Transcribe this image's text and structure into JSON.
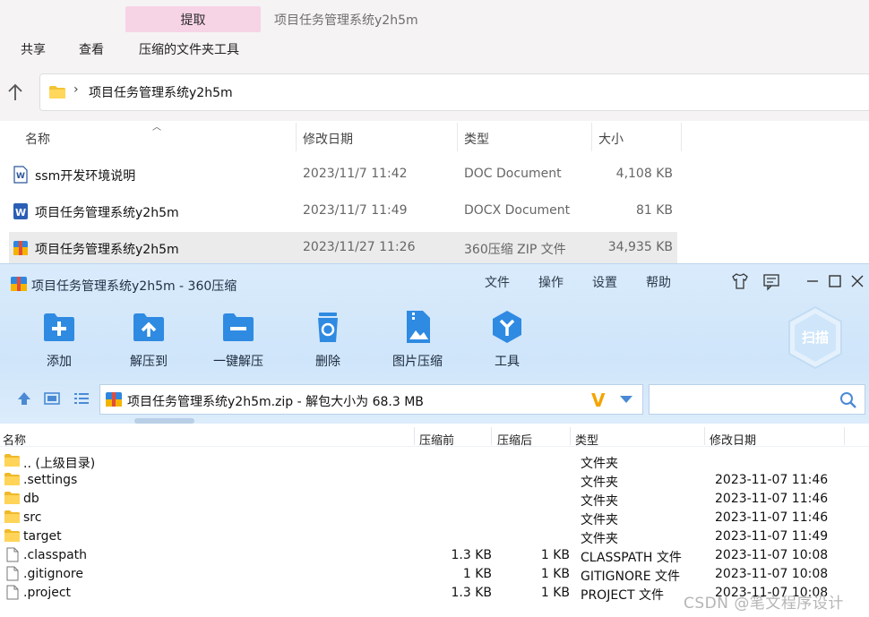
{
  "explorer": {
    "context_tab": "提取",
    "window_title": "项目任务管理系统y2h5m",
    "menus": [
      "共享",
      "查看",
      "压缩的文件夹工具"
    ],
    "address": {
      "path": "项目任务管理系统y2h5m"
    },
    "columns": {
      "name": "名称",
      "date": "修改日期",
      "type": "类型",
      "size": "大小"
    },
    "files": [
      {
        "name": "ssm开发环境说明",
        "date": "2023/11/7 11:42",
        "type": "DOC Document",
        "size": "4,108 KB",
        "icon": "word-doc-icon"
      },
      {
        "name": "项目任务管理系统y2h5m",
        "date": "2023/11/7 11:49",
        "type": "DOCX Document",
        "size": "81 KB",
        "icon": "word-docx-icon"
      },
      {
        "name": "项目任务管理系统y2h5m",
        "date": "2023/11/27 11:26",
        "type": "360压缩 ZIP 文件",
        "size": "34,935 KB",
        "icon": "zip-archive-icon"
      }
    ]
  },
  "zip_window": {
    "title": "项目任务管理系统y2h5m - 360压缩",
    "menus": [
      "文件",
      "操作",
      "设置",
      "帮助"
    ],
    "toolbar": [
      {
        "label": "添加",
        "icon": "add-icon"
      },
      {
        "label": "解压到",
        "icon": "extract-to-icon"
      },
      {
        "label": "一键解压",
        "icon": "one-click-extract-icon"
      },
      {
        "label": "删除",
        "icon": "recycle-delete-icon"
      },
      {
        "label": "图片压缩",
        "icon": "image-compress-icon"
      },
      {
        "label": "工具",
        "icon": "tools-icon"
      }
    ],
    "scan_label": "扫描",
    "path_text": "项目任务管理系统y2h5m.zip - 解包大小为 68.3 MB",
    "search_placeholder": "",
    "columns": {
      "name": "名称",
      "before": "压缩前",
      "after": "压缩后",
      "type": "类型",
      "date": "修改日期"
    },
    "rows": [
      {
        "name": ".. (上级目录)",
        "before": "",
        "after": "",
        "type": "文件夹",
        "date": "",
        "icon": "folder-icon"
      },
      {
        "name": ".settings",
        "before": "",
        "after": "",
        "type": "文件夹",
        "date": "2023-11-07 11:46",
        "icon": "folder-icon"
      },
      {
        "name": "db",
        "before": "",
        "after": "",
        "type": "文件夹",
        "date": "2023-11-07 11:46",
        "icon": "folder-icon"
      },
      {
        "name": "src",
        "before": "",
        "after": "",
        "type": "文件夹",
        "date": "2023-11-07 11:46",
        "icon": "folder-icon"
      },
      {
        "name": "target",
        "before": "",
        "after": "",
        "type": "文件夹",
        "date": "2023-11-07 11:49",
        "icon": "folder-icon"
      },
      {
        "name": ".classpath",
        "before": "1.3 KB",
        "after": "1 KB",
        "type": "CLASSPATH 文件",
        "date": "2023-11-07 10:08",
        "icon": "file-icon"
      },
      {
        "name": ".gitignore",
        "before": "1 KB",
        "after": "1 KB",
        "type": "GITIGNORE 文件",
        "date": "2023-11-07 10:08",
        "icon": "file-icon"
      },
      {
        "name": ".project",
        "before": "1.3 KB",
        "after": "1 KB",
        "type": "PROJECT 文件",
        "date": "2023-11-07 10:08",
        "icon": "file-icon"
      }
    ]
  },
  "watermark": "CSDN @笔文程序设计",
  "colors": {
    "ribbon_bg": "#f5f3f4",
    "context_tab": "#f7d3e6",
    "zip_header_bg": "#d9ebfb",
    "zip_accent": "#2f86de"
  }
}
